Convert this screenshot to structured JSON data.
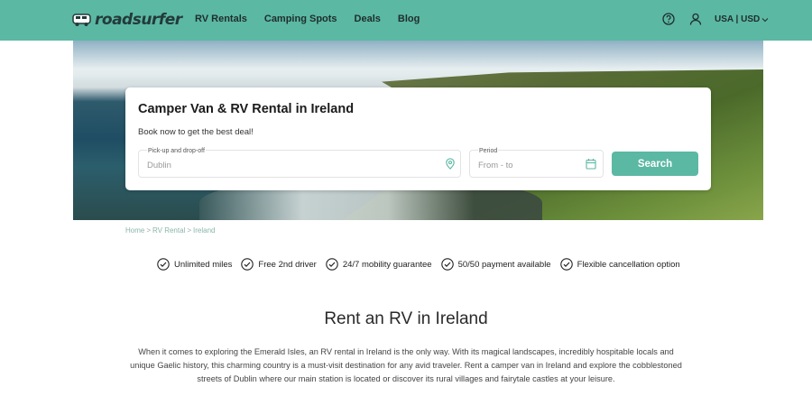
{
  "header": {
    "logo_text": "roadsurfer",
    "nav": [
      "RV Rentals",
      "Camping Spots",
      "Deals",
      "Blog"
    ],
    "locale": "USA | USD",
    "icons": [
      "help-icon",
      "user-icon",
      "chevron-down-icon"
    ],
    "bg_color": "#5bb8a3"
  },
  "search_card": {
    "title": "Camper Van & RV Rental in Ireland",
    "subtitle": "Book now to get the best deal!",
    "location_label": "Pick-up and drop-off",
    "location_value": "Dublin",
    "period_label": "Period",
    "period_placeholder": "From - to",
    "search_label": "Search"
  },
  "breadcrumb": [
    "Home",
    ">",
    "RV Rental",
    ">",
    "Ireland"
  ],
  "features": [
    "Unlimited miles",
    "Free 2nd driver",
    "24/7 mobility guarantee",
    "50/50 payment available",
    "Flexible cancellation option"
  ],
  "intro": {
    "title": "Rent an RV in Ireland",
    "text": "When it comes to exploring the Emerald Isles, an RV rental in Ireland is the only way. With its magical landscapes, incredibly hospitable locals and unique Gaelic history, this charming country is a must-visit destination for any avid traveler. Rent a camper van in Ireland and explore the cobblestoned streets of Dublin where our main station is located or discover its rural villages and fairytale castles at your leisure."
  },
  "colors": {
    "accent": "#5bb8a3",
    "text_dark": "#1f2d2d"
  }
}
